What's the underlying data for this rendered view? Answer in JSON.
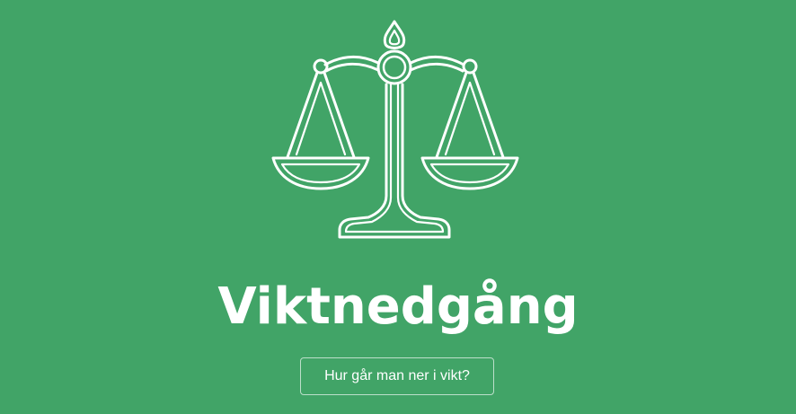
{
  "hero": {
    "icon": "balance-scale-icon",
    "title": "Viktnedgång",
    "button_label": "Hur går man ner i vikt?"
  },
  "colors": {
    "background": "#41a467",
    "foreground": "#ffffff"
  }
}
